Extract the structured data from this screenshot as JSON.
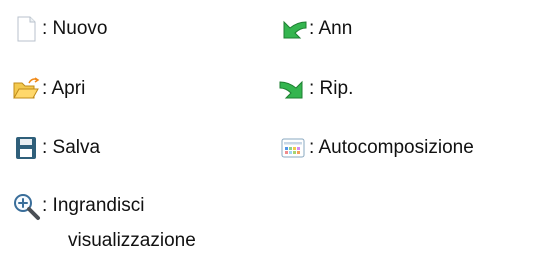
{
  "legend": {
    "items": [
      {
        "id": "new",
        "icon": "new-document-icon",
        "label": ": Nuovo"
      },
      {
        "id": "undo",
        "icon": "undo-arrow-icon",
        "label": ": Ann"
      },
      {
        "id": "open",
        "icon": "open-folder-icon",
        "label": ": Apri"
      },
      {
        "id": "redo",
        "icon": "redo-arrow-icon",
        "label": ": Rip."
      },
      {
        "id": "save",
        "icon": "save-floppy-icon",
        "label": ": Salva"
      },
      {
        "id": "autolayout",
        "icon": "autolayout-icon",
        "label": ": Autocomposizione"
      },
      {
        "id": "zoom",
        "icon": "zoom-in-icon",
        "label_line1": ": Ingrandisci",
        "label_line2": "visualizzazione"
      }
    ]
  }
}
